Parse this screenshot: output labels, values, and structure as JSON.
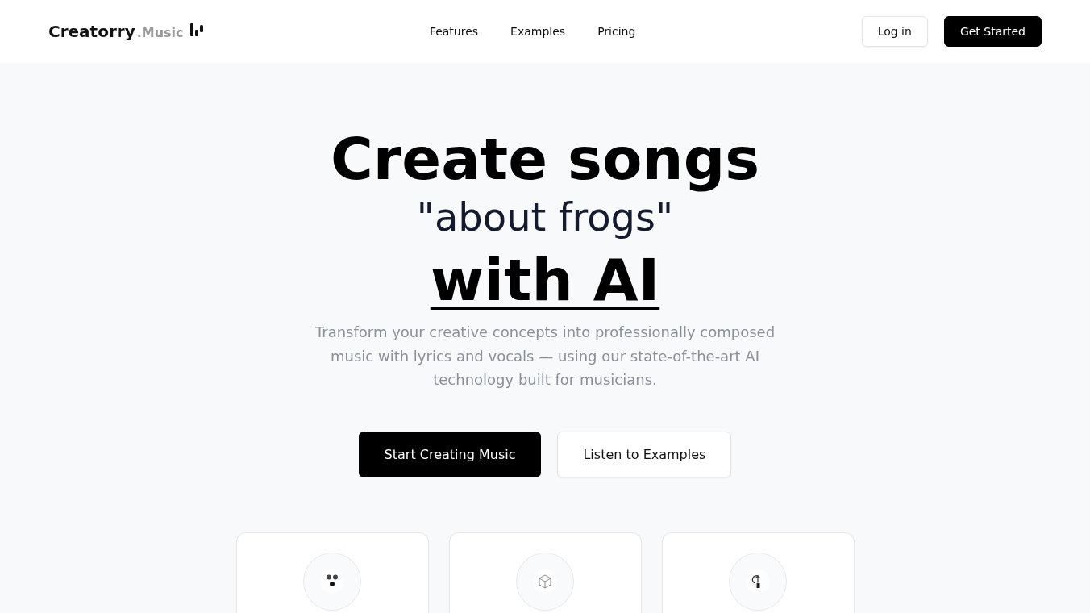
{
  "header": {
    "logo": {
      "name": "Creatorry",
      "suffix": ".Music"
    },
    "nav": [
      "Features",
      "Examples",
      "Pricing"
    ],
    "buttons": [
      {
        "label": "Log in",
        "kind": "secondary"
      },
      {
        "label": "Get Started",
        "kind": "primary"
      }
    ]
  },
  "hero": {
    "headline": "Create songs",
    "prompt_example": "\"about frogs\"",
    "headline_end": "with AI",
    "description": "Transform your creative concepts into professionally composed music with lyrics and vocals — using our state-of-the-art AI technology built for musicians.",
    "buttons": [
      {
        "label": "Start Creating Music",
        "kind": "primary"
      },
      {
        "label": "Listen to Examples",
        "kind": "secondary"
      }
    ]
  }
}
